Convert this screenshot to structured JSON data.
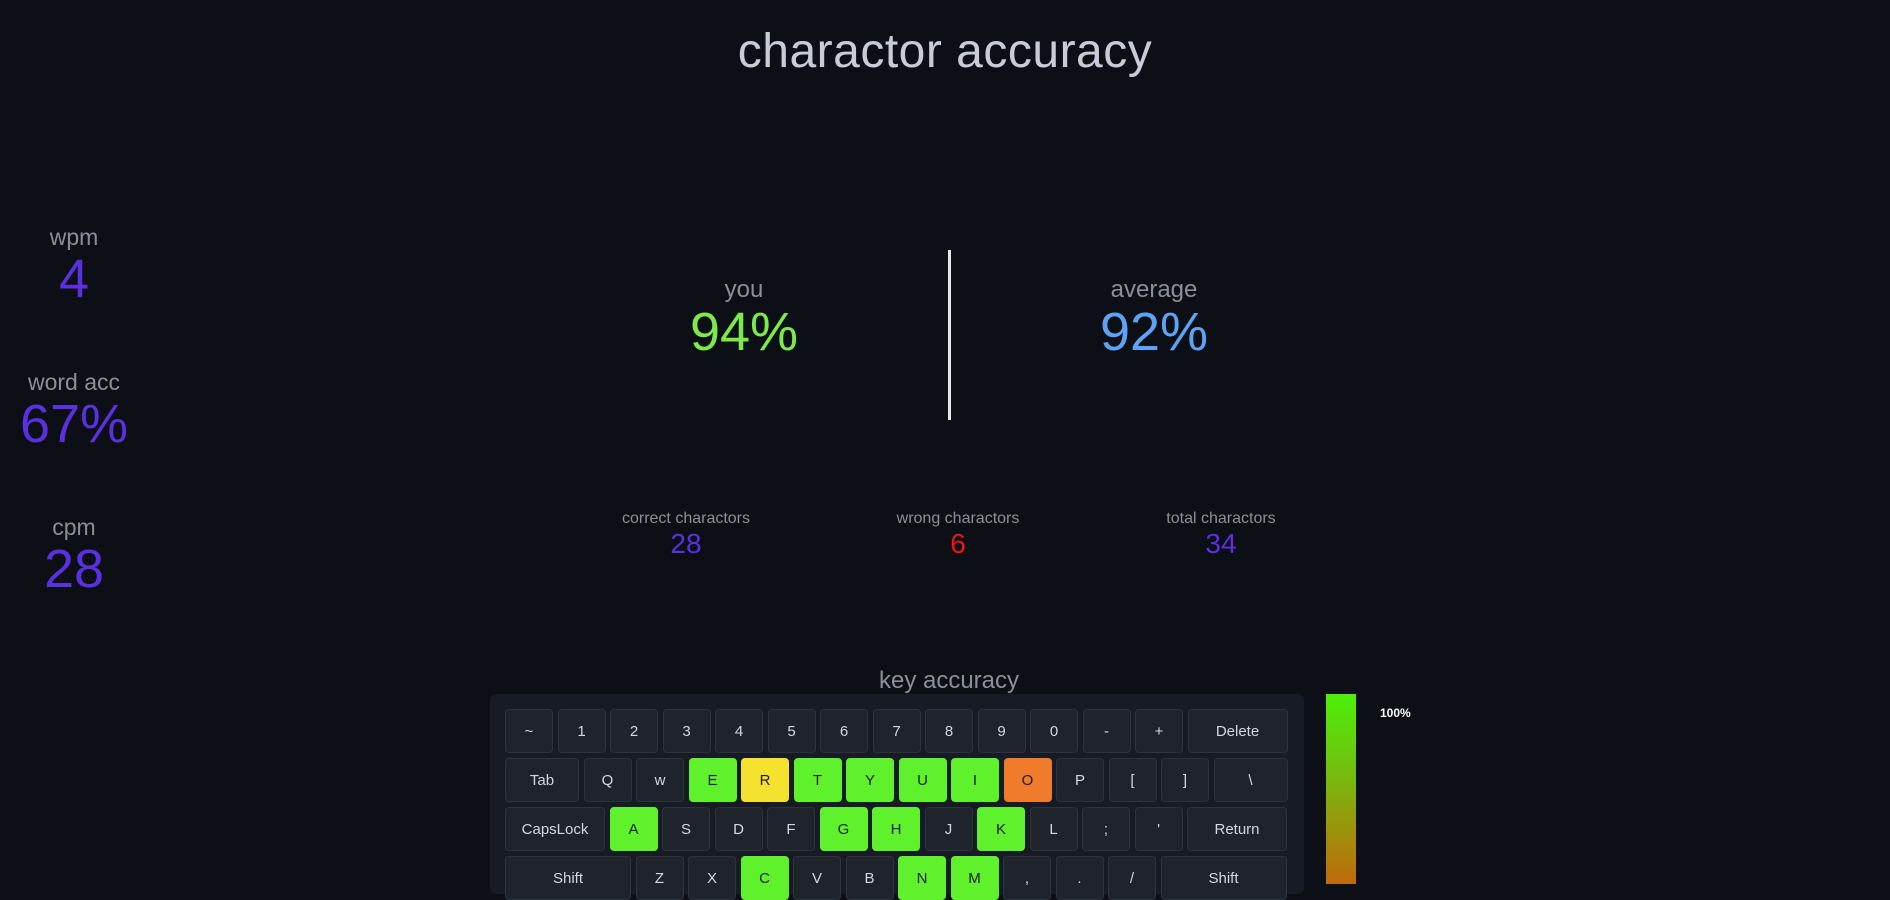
{
  "title": "charactor accuracy",
  "side_stats": [
    {
      "label": "wpm",
      "value": "4"
    },
    {
      "label": "word acc",
      "value": "67%"
    },
    {
      "label": "cpm",
      "value": "28"
    }
  ],
  "accuracy": {
    "you": {
      "label": "you",
      "value": "94%"
    },
    "average": {
      "label": "average",
      "value": "92%"
    }
  },
  "counts": {
    "correct": {
      "label": "correct charactors",
      "value": "28"
    },
    "wrong": {
      "label": "wrong charactors",
      "value": "6"
    },
    "total": {
      "label": "total charactors",
      "value": "34"
    }
  },
  "key_accuracy": {
    "title": "key accuracy",
    "scale_label": "100%"
  },
  "keyboard": {
    "rows": [
      [
        {
          "label": "~",
          "state": "none"
        },
        {
          "label": "1",
          "state": "none"
        },
        {
          "label": "2",
          "state": "none"
        },
        {
          "label": "3",
          "state": "none"
        },
        {
          "label": "4",
          "state": "none"
        },
        {
          "label": "5",
          "state": "none"
        },
        {
          "label": "6",
          "state": "none"
        },
        {
          "label": "7",
          "state": "none"
        },
        {
          "label": "8",
          "state": "none"
        },
        {
          "label": "9",
          "state": "none"
        },
        {
          "label": "0",
          "state": "none"
        },
        {
          "label": "-",
          "state": "none"
        },
        {
          "label": "+",
          "state": "none"
        },
        {
          "label": "Delete",
          "state": "none"
        }
      ],
      [
        {
          "label": "Tab",
          "state": "none"
        },
        {
          "label": "Q",
          "state": "none"
        },
        {
          "label": "w",
          "state": "none"
        },
        {
          "label": "E",
          "state": "green"
        },
        {
          "label": "R",
          "state": "yellow"
        },
        {
          "label": "T",
          "state": "green"
        },
        {
          "label": "Y",
          "state": "green"
        },
        {
          "label": "U",
          "state": "green"
        },
        {
          "label": "I",
          "state": "green"
        },
        {
          "label": "O",
          "state": "orange"
        },
        {
          "label": "P",
          "state": "none"
        },
        {
          "label": "[",
          "state": "none"
        },
        {
          "label": "]",
          "state": "none"
        },
        {
          "label": "\\",
          "state": "none"
        }
      ],
      [
        {
          "label": "CapsLock",
          "state": "none"
        },
        {
          "label": "A",
          "state": "green"
        },
        {
          "label": "S",
          "state": "none"
        },
        {
          "label": "D",
          "state": "none"
        },
        {
          "label": "F",
          "state": "none"
        },
        {
          "label": "G",
          "state": "green"
        },
        {
          "label": "H",
          "state": "green"
        },
        {
          "label": "J",
          "state": "none"
        },
        {
          "label": "K",
          "state": "green"
        },
        {
          "label": "L",
          "state": "none"
        },
        {
          "label": ";",
          "state": "none"
        },
        {
          "label": "'",
          "state": "none"
        },
        {
          "label": "Return",
          "state": "none"
        }
      ],
      [
        {
          "label": "Shift",
          "state": "none"
        },
        {
          "label": "Z",
          "state": "none"
        },
        {
          "label": "X",
          "state": "none"
        },
        {
          "label": "C",
          "state": "green"
        },
        {
          "label": "V",
          "state": "none"
        },
        {
          "label": "B",
          "state": "none"
        },
        {
          "label": "N",
          "state": "green"
        },
        {
          "label": "M",
          "state": "green"
        },
        {
          "label": ",",
          "state": "none"
        },
        {
          "label": ".",
          "state": "none"
        },
        {
          "label": "/",
          "state": "none"
        },
        {
          "label": "Shift",
          "state": "none"
        }
      ]
    ]
  },
  "colors": {
    "accent_purple": "#5b30e0",
    "you_green": "#7ee94a",
    "average_blue": "#5ea2f4",
    "wrong_red": "#ee1515",
    "key_green": "#5ff22c",
    "key_yellow": "#f4e22e",
    "key_orange": "#f07b2c"
  }
}
